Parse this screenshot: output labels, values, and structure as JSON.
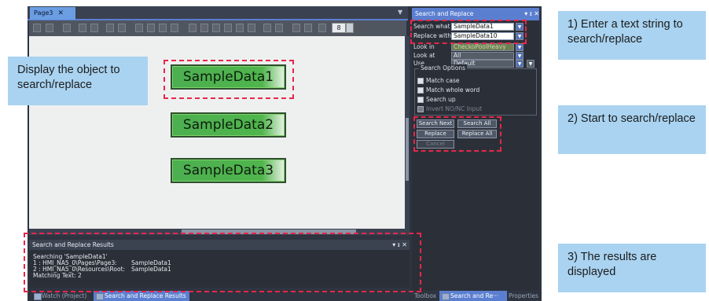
{
  "document": {
    "tab_label": "Page3",
    "zoom_value": "8",
    "sample_buttons": [
      "SampleData1",
      "SampleData2",
      "SampleData3"
    ]
  },
  "panel": {
    "title": "Search and Replace",
    "search_what_label": "Search what",
    "search_what_value": "SampleData1",
    "replace_with_label": "Replace with",
    "replace_with_value": "SampleData10",
    "look_in_label": "Look in",
    "look_in_value": "CheckoPoolHeavy",
    "look_at_label": "Look at",
    "look_at_value": "All",
    "use_label": "Use",
    "use_value": "Default",
    "options_title": "Search Options",
    "options": [
      {
        "label": "Match case",
        "enabled": true
      },
      {
        "label": "Match whole word",
        "enabled": true
      },
      {
        "label": "Search up",
        "enabled": true
      },
      {
        "label": "Invert NO/NC Input",
        "enabled": false
      }
    ],
    "buttons": {
      "search_next": "Search Next",
      "search_all": "Search All",
      "replace": "Replace",
      "replace_all": "Replace All",
      "cancel": "Cancel"
    }
  },
  "results": {
    "title": "Search and Replace Results",
    "lines": [
      {
        "path": "Searching 'SampleData1'",
        "value": ""
      },
      {
        "path": "1 : HMI_NA5_0\\Pages\\Page3:",
        "value": "SampleData1"
      },
      {
        "path": "2 : HMI_NA5_0\\Resources\\Root:",
        "value": "SampleData1"
      },
      {
        "path": "Matching Text: 2",
        "value": ""
      }
    ]
  },
  "bottom_tabs": {
    "watch": "Watch (Project)",
    "results": "Search and Replace Results"
  },
  "right_tabs": {
    "toolbox": "Toolbox",
    "search": "Search and Re···",
    "properties": "Properties"
  },
  "callouts": {
    "display": "Display the object to search/replace",
    "step1": "1) Enter a text string to search/replace",
    "step2": "2) Start to search/replace",
    "step3": "3) The results are displayed"
  },
  "colors": {
    "highlight": "#e8264a",
    "callout_fill": "#a9d3f1",
    "accent_tab": "#5b7fd0",
    "sample_button_green": "#4caf50"
  }
}
